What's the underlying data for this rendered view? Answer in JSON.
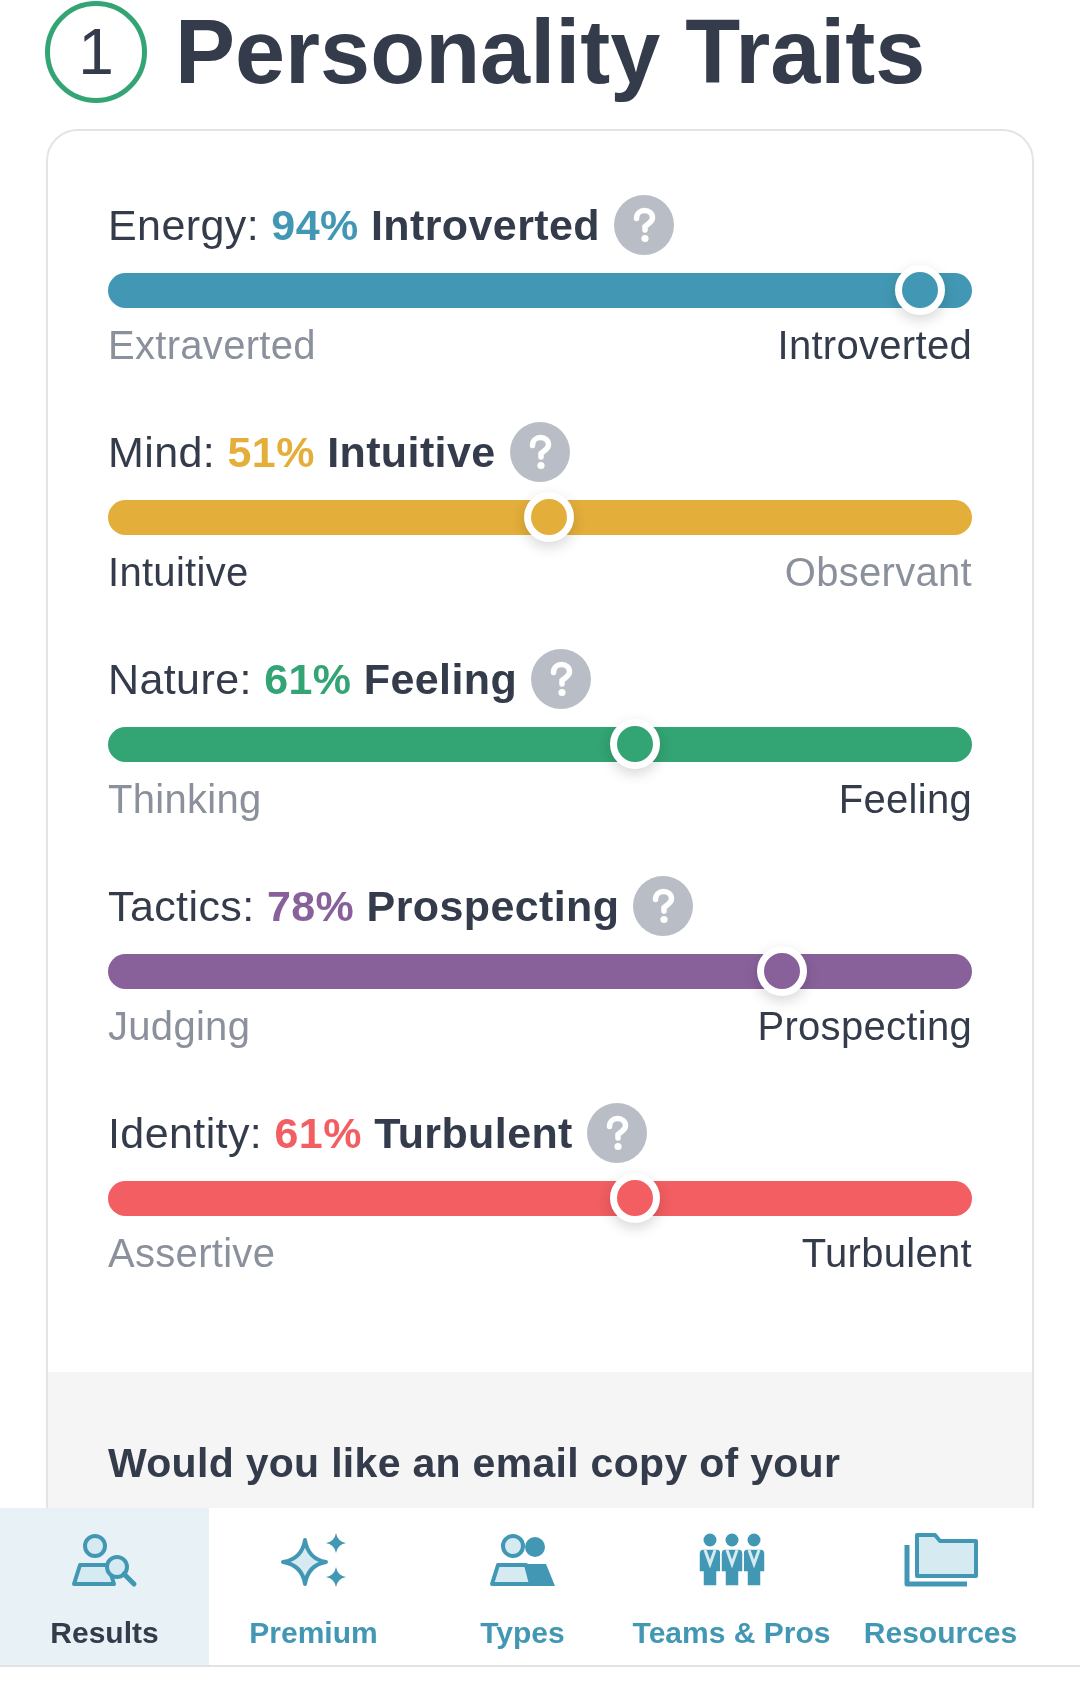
{
  "header": {
    "step": "1",
    "title": "Personality Traits"
  },
  "traits": [
    {
      "name": "Energy:",
      "percent": "94%",
      "trait": "Introverted",
      "color": "#4298b4",
      "level": 0.94,
      "poles": [
        {
          "label": "Extraverted",
          "selected": false
        },
        {
          "label": "Introverted",
          "selected": true
        }
      ]
    },
    {
      "name": "Mind:",
      "percent": "51%",
      "trait": "Intuitive",
      "color": "#e4ae3a",
      "level": 0.51,
      "poles": [
        {
          "label": "Intuitive",
          "selected": true
        },
        {
          "label": "Observant",
          "selected": false
        }
      ]
    },
    {
      "name": "Nature:",
      "percent": "61%",
      "trait": "Feeling",
      "color": "#33a474",
      "level": 0.61,
      "poles": [
        {
          "label": "Thinking",
          "selected": false
        },
        {
          "label": "Feeling",
          "selected": true
        }
      ]
    },
    {
      "name": "Tactics:",
      "percent": "78%",
      "trait": "Prospecting",
      "color": "#88619a",
      "level": 0.78,
      "poles": [
        {
          "label": "Judging",
          "selected": false
        },
        {
          "label": "Prospecting",
          "selected": true
        }
      ]
    },
    {
      "name": "Identity:",
      "percent": "61%",
      "trait": "Turbulent",
      "color": "#f25e62",
      "level": 0.61,
      "poles": [
        {
          "label": "Assertive",
          "selected": false
        },
        {
          "label": "Turbulent",
          "selected": true
        }
      ]
    }
  ],
  "email_prompt": {
    "text": "Would you like an email copy of your"
  },
  "bottom_nav": [
    {
      "label": "Results",
      "kind": "person-search",
      "selected": true
    },
    {
      "label": "Premium",
      "kind": "sparkles",
      "selected": false
    },
    {
      "label": "Types",
      "kind": "people",
      "selected": false
    },
    {
      "label": "Teams & Pros",
      "kind": "team",
      "selected": false
    },
    {
      "label": "Resources",
      "kind": "folders",
      "selected": false
    }
  ]
}
